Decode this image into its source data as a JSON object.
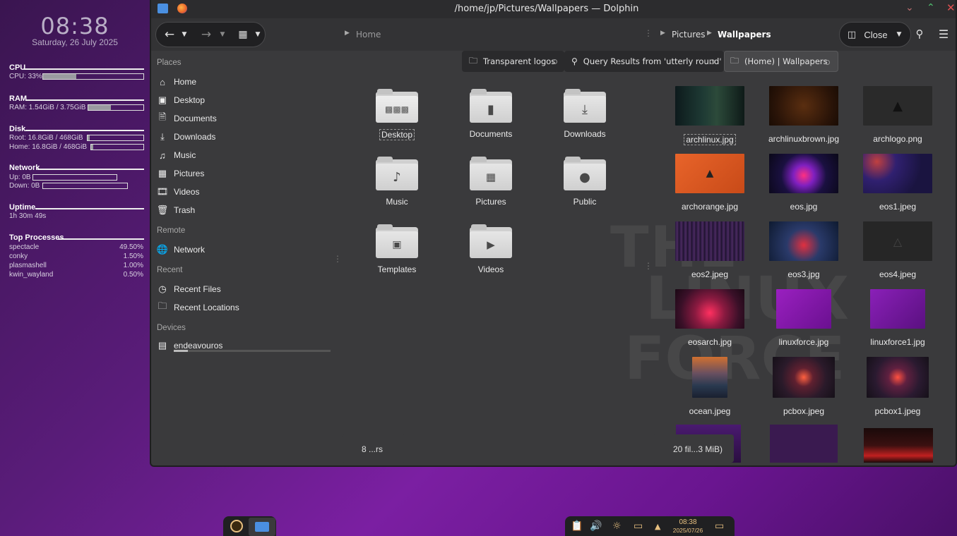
{
  "conky": {
    "time": "08:38",
    "date": "Saturday, 26 July 2025",
    "cpu": {
      "title": "CPU",
      "line": "CPU: 33%",
      "usage": 0.33
    },
    "ram": {
      "title": "RAM",
      "line": "RAM: 1.54GiB / 3.75GiB",
      "usage": 0.41
    },
    "disk": {
      "title": "Disk",
      "root": "Root: 16.8GiB / 468GiB",
      "home": "Home: 16.8GiB / 468GiB",
      "usage": 0.04
    },
    "network": {
      "title": "Network",
      "up": "Up: 0B",
      "down": "Down: 0B"
    },
    "uptime": {
      "title": "Uptime",
      "value": "1h 30m 49s"
    },
    "processes": {
      "title": "Top Processes",
      "items": [
        {
          "name": "spectacle",
          "value": "49.50%"
        },
        {
          "name": "conky",
          "value": "1.50%"
        },
        {
          "name": "plasmashell",
          "value": "1.00%"
        },
        {
          "name": "kwin_wayland",
          "value": "0.50%"
        }
      ]
    }
  },
  "window": {
    "title": "/home/jp/Pictures/Wallpapers — Dolphin",
    "breadcrumb_left": "Home",
    "breadcrumb_right": [
      "Pictures",
      "Wallpapers"
    ],
    "close_label": "Close",
    "tabs": [
      {
        "label": "Transparent logos"
      },
      {
        "label": "Query Results from 'utterly round'"
      },
      {
        "label": "(Home) | Wallpapers"
      }
    ]
  },
  "sidebar": {
    "places_title": "Places",
    "places": [
      "Home",
      "Desktop",
      "Documents",
      "Downloads",
      "Music",
      "Pictures",
      "Videos",
      "Trash"
    ],
    "remote_title": "Remote",
    "remote": [
      "Network"
    ],
    "recent_title": "Recent",
    "recent": [
      "Recent Files",
      "Recent Locations"
    ],
    "devices_title": "Devices",
    "devices": [
      "endeavouros"
    ]
  },
  "home_folders": [
    "Desktop",
    "Documents",
    "Downloads",
    "Music",
    "Pictures",
    "Public",
    "Templates",
    "Videos"
  ],
  "wallpapers": [
    "archlinux.jpg",
    "archlinuxbrown.jpg",
    "archlogo.png",
    "archorange.jpg",
    "eos.jpg",
    "eos1.jpeg",
    "eos2.jpeg",
    "eos3.jpg",
    "eos4.jpeg",
    "eosarch.jpg",
    "linuxforce.jpg",
    "linuxforce1.jpg",
    "ocean.jpeg",
    "pcbox.jpeg",
    "pcbox1.jpeg"
  ],
  "status": {
    "left": "8 ...rs",
    "right": "20 fil...3 MiB)"
  },
  "background_text": [
    "THE",
    "LINUX",
    "FORCE"
  ],
  "taskbar": {
    "time": "08:38",
    "date": "2025/07/26"
  },
  "colors": {
    "accent": "#e8c080",
    "window_bg": "#3a3a3c",
    "desktop": "#6a1b9a"
  }
}
